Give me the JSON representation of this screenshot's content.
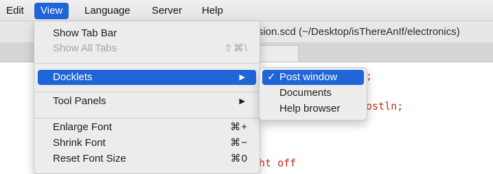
{
  "menubar": {
    "items": [
      "Edit",
      "View",
      "Language",
      "Server",
      "Help"
    ]
  },
  "window": {
    "title": "vision.scd (~/Desktop/isThereAnIf/electronics)"
  },
  "code_fragments": [
    ";",
    "ostln;",
    "ht off"
  ],
  "view_menu": {
    "show_tab_bar": "Show Tab Bar",
    "show_all_tabs": "Show All Tabs",
    "show_all_tabs_shortcut": "⇧⌘\\",
    "docklets": "Docklets",
    "tool_panels": "Tool Panels",
    "submenu_arrow": "▶",
    "enlarge_font": "Enlarge Font",
    "enlarge_font_shortcut": "⌘+",
    "shrink_font": "Shrink Font",
    "shrink_font_shortcut": "⌘−",
    "reset_font_size": "Reset Font Size",
    "reset_font_size_shortcut": "⌘0"
  },
  "docklets_submenu": {
    "items": [
      {
        "label": "Post window",
        "checked": true
      },
      {
        "label": "Documents",
        "checked": false
      },
      {
        "label": "Help browser",
        "checked": false
      }
    ],
    "check_mark": "✓"
  },
  "colors": {
    "highlight": "#1f65d8",
    "code_red": "#c02a1e"
  }
}
